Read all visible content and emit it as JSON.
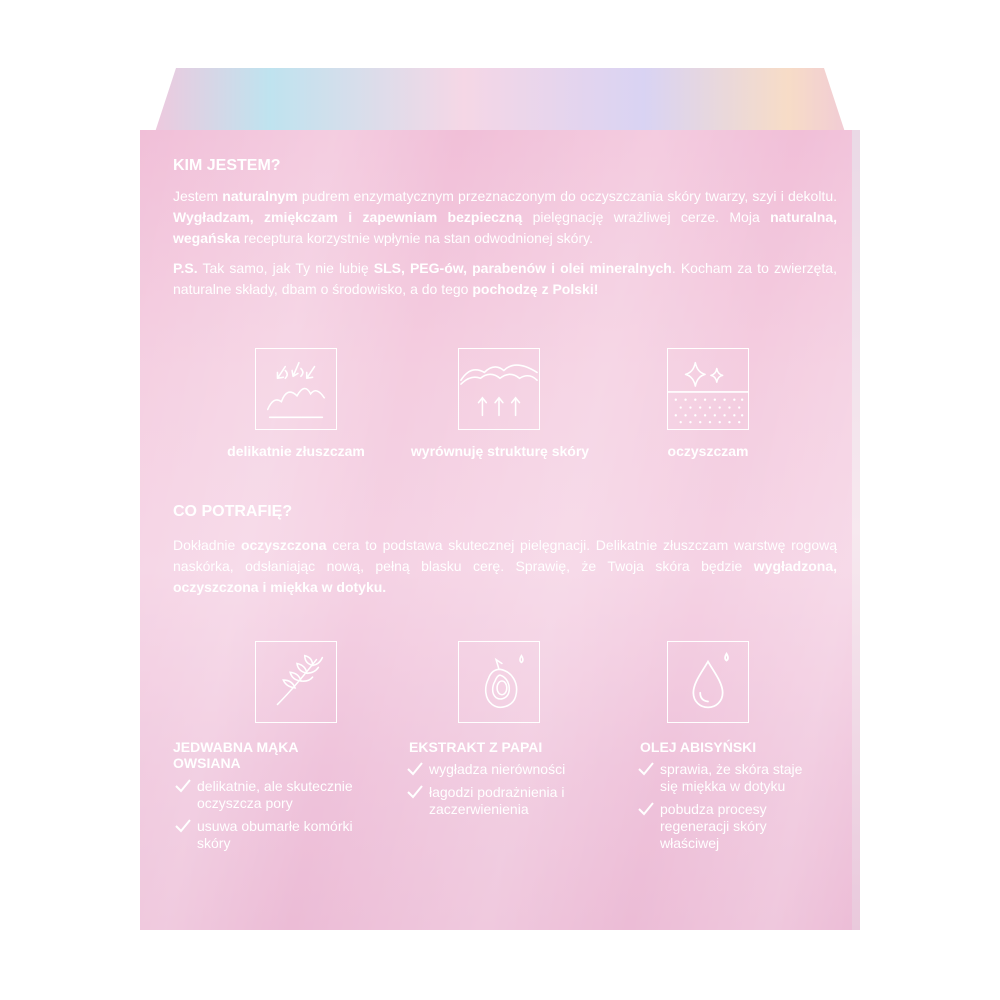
{
  "kim": {
    "heading": "KIM JESTEM?",
    "p1": [
      {
        "t": "Jestem ",
        "b": false
      },
      {
        "t": "naturalnym",
        "b": true
      },
      {
        "t": " pudrem enzymatycznym przeznaczonym do oczyszczania skóry twarzy, szyi i dekoltu. ",
        "b": false
      },
      {
        "t": "Wygładzam, zmiękczam i zapewniam bezpieczną",
        "b": true
      },
      {
        "t": " pielęgnację wrażliwej cerze. Moja ",
        "b": false
      },
      {
        "t": "naturalna, wegańska",
        "b": true
      },
      {
        "t": " receptura korzystnie wpłynie na stan odwodnionej skóry.",
        "b": false
      }
    ],
    "p2": [
      {
        "t": "P.S.",
        "b": true
      },
      {
        "t": " Tak samo, jak Ty nie lubię ",
        "b": false
      },
      {
        "t": "SLS, PEG-ów, parabenów i olei mineralnych",
        "b": true
      },
      {
        "t": ". Kocham za to zwierzęta, naturalne składy, dbam o środowisko, a do tego ",
        "b": false
      },
      {
        "t": "pochodzę z Polski!",
        "b": true
      }
    ]
  },
  "features": [
    {
      "icon": "exfoliation-icon",
      "label": "delikatnie złuszczam"
    },
    {
      "icon": "skin-structure-icon",
      "label": "wyrównuję strukturę skóry"
    },
    {
      "icon": "sparkle-clean-icon",
      "label": "oczyszczam"
    }
  ],
  "co": {
    "heading": "CO POTRAFIĘ?",
    "p1": [
      {
        "t": "Dokładnie ",
        "b": false
      },
      {
        "t": "oczyszczona",
        "b": true
      },
      {
        "t": " cera to podstawa skutecznej pielęgnacji. Delikatnie złuszczam warstwę rogową naskórka, odsłaniając nową, pełną blasku cerę. Sprawię, że Twoja skóra będzie ",
        "b": false
      },
      {
        "t": "wygładzona, oczyszczona i miękka w dotyku.",
        "b": true
      }
    ]
  },
  "ingredients": [
    {
      "icon": "oat-icon",
      "title": "JEDWABNA MĄKA OWSIANA",
      "benefits": [
        "delikatnie, ale skutecznie oczyszcza pory",
        "usuwa obumarłe komórki skóry"
      ]
    },
    {
      "icon": "papaya-icon",
      "title": "EKSTRAKT Z PAPAI",
      "benefits": [
        "wygładza nierówności",
        "łagodzi podrażnienia i zaczerwienienia"
      ]
    },
    {
      "icon": "oil-drop-icon",
      "title": "OLEJ ABISYŃSKI",
      "benefits": [
        "sprawia, że skóra staje się miękka w dotyku",
        "pobudza procesy regeneracji skóry właściwej"
      ]
    }
  ],
  "colors": {
    "box": "#f4cde0",
    "text": "#ffffff"
  }
}
